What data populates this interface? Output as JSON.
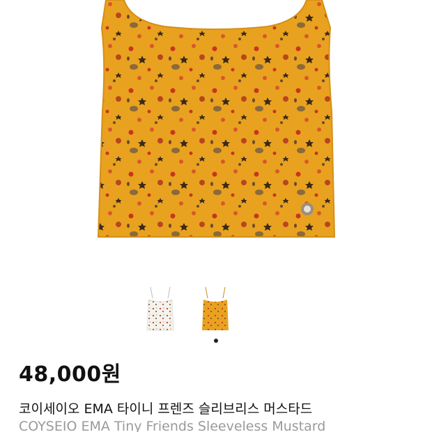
{
  "product": {
    "price": "48,000원",
    "title_ko": "코이세이오 EMA 타이니 프렌즈 슬리브리스 머스타드",
    "title_en": "COYSEIO EMA Tiny Friends Sleeveless Mustard"
  },
  "gallery": {
    "main_image": "mustard-sleeveless-top",
    "thumbnails": [
      "white-sleeveless-top",
      "mustard-sleeveless-top"
    ],
    "active_index": 1,
    "colors": {
      "mustard": "#E9A21F",
      "white": "#F4F2EE",
      "print_red": "#C8351E",
      "print_brown": "#6B4A2A",
      "print_dark": "#3A2A1A"
    }
  }
}
